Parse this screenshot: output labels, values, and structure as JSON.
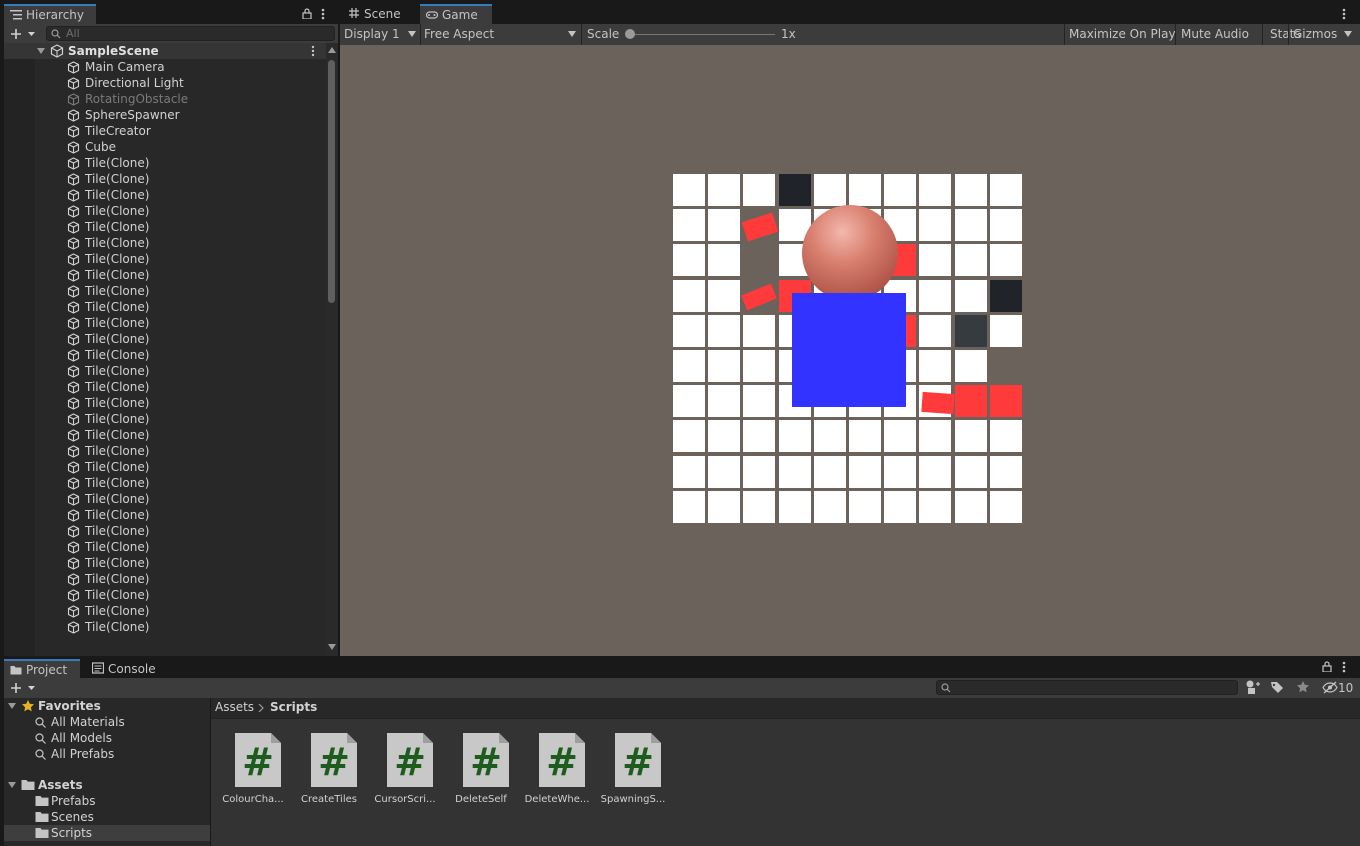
{
  "hierarchy": {
    "tab_label": "Hierarchy",
    "search_placeholder": "All",
    "scene_name": "SampleScene",
    "objects": [
      {
        "label": "Main Camera",
        "active": true
      },
      {
        "label": "Directional Light",
        "active": true
      },
      {
        "label": "RotatingObstacle",
        "active": false
      },
      {
        "label": "SphereSpawner",
        "active": true
      },
      {
        "label": "TileCreator",
        "active": true
      },
      {
        "label": "Cube",
        "active": true
      },
      {
        "label": "Tile(Clone)",
        "active": true
      },
      {
        "label": "Tile(Clone)",
        "active": true
      },
      {
        "label": "Tile(Clone)",
        "active": true
      },
      {
        "label": "Tile(Clone)",
        "active": true
      },
      {
        "label": "Tile(Clone)",
        "active": true
      },
      {
        "label": "Tile(Clone)",
        "active": true
      },
      {
        "label": "Tile(Clone)",
        "active": true
      },
      {
        "label": "Tile(Clone)",
        "active": true
      },
      {
        "label": "Tile(Clone)",
        "active": true
      },
      {
        "label": "Tile(Clone)",
        "active": true
      },
      {
        "label": "Tile(Clone)",
        "active": true
      },
      {
        "label": "Tile(Clone)",
        "active": true
      },
      {
        "label": "Tile(Clone)",
        "active": true
      },
      {
        "label": "Tile(Clone)",
        "active": true
      },
      {
        "label": "Tile(Clone)",
        "active": true
      },
      {
        "label": "Tile(Clone)",
        "active": true
      },
      {
        "label": "Tile(Clone)",
        "active": true
      },
      {
        "label": "Tile(Clone)",
        "active": true
      },
      {
        "label": "Tile(Clone)",
        "active": true
      },
      {
        "label": "Tile(Clone)",
        "active": true
      },
      {
        "label": "Tile(Clone)",
        "active": true
      },
      {
        "label": "Tile(Clone)",
        "active": true
      },
      {
        "label": "Tile(Clone)",
        "active": true
      },
      {
        "label": "Tile(Clone)",
        "active": true
      },
      {
        "label": "Tile(Clone)",
        "active": true
      },
      {
        "label": "Tile(Clone)",
        "active": true
      },
      {
        "label": "Tile(Clone)",
        "active": true
      },
      {
        "label": "Tile(Clone)",
        "active": true
      },
      {
        "label": "Tile(Clone)",
        "active": true
      },
      {
        "label": "Tile(Clone)",
        "active": true
      }
    ]
  },
  "view_tabs": {
    "scene": "Scene",
    "game": "Game"
  },
  "game_toolbar": {
    "display": "Display 1",
    "aspect": "Free Aspect",
    "scale_label": "Scale",
    "scale_value": "1x",
    "maximize": "Maximize On Play",
    "mute": "Mute Audio",
    "stats": "Stats",
    "gizmos": "Gizmos"
  },
  "bottom_tabs": {
    "project": "Project",
    "console": "Console"
  },
  "project": {
    "hidden_count": "10",
    "favorites": {
      "label": "Favorites",
      "items": [
        "All Materials",
        "All Models",
        "All Prefabs"
      ]
    },
    "assets": {
      "label": "Assets",
      "items": [
        "Prefabs",
        "Scenes",
        "Scripts"
      ]
    },
    "breadcrumb": {
      "root": "Assets",
      "current": "Scripts"
    },
    "files": [
      "ColourCha...",
      "CreateTiles",
      "CursorScri...",
      "DeleteSelf",
      "DeleteWhe...",
      "SpawningS..."
    ]
  },
  "colors": {
    "accent": "#3a79bb",
    "game_bg": "#6b625c",
    "tile": "#ffffff",
    "tile_red": "#ff3a3a",
    "player": "#3333ff",
    "sphere": "#d98070",
    "script_hash": "#1e5c1e"
  },
  "game": {
    "grid_rows": 10,
    "grid_cols": 10,
    "missing_tiles": [
      "r1c2",
      "r2c2",
      "r3c2",
      "r4c8",
      "r5c9",
      "r6c8"
    ],
    "red_tiles": [
      "r2c6",
      "r3c3",
      "r4c6",
      "r6c8",
      "r6c9"
    ],
    "dark_tiles": [
      "r0c3",
      "r3c9"
    ],
    "grey_tiles": [
      "r4c8"
    ]
  }
}
